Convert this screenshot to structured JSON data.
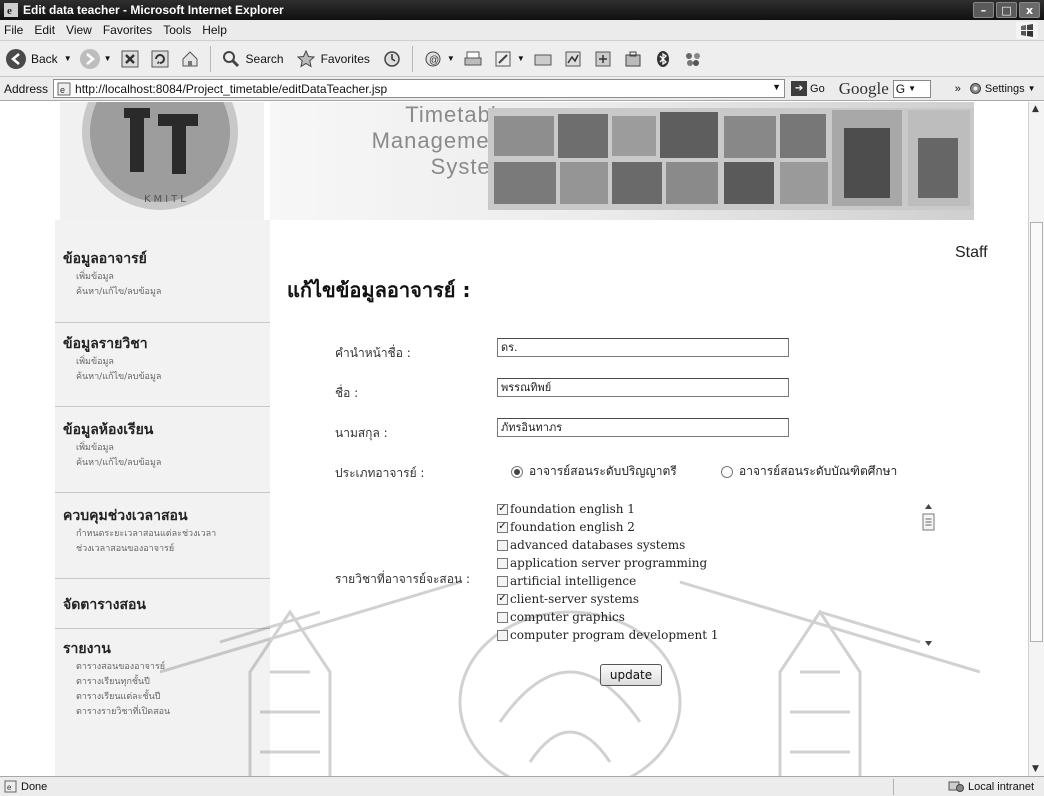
{
  "window": {
    "title": "Edit data teacher - Microsoft Internet Explorer"
  },
  "menu": [
    "File",
    "Edit",
    "View",
    "Favorites",
    "Tools",
    "Help"
  ],
  "toolbar": {
    "back_label": "Back",
    "search_label": "Search",
    "favorites_label": "Favorites"
  },
  "address": {
    "label": "Address",
    "url": "http://localhost:8084/Project_timetable/editDataTeacher.jsp",
    "go_label": "Go",
    "google_label": "Google",
    "google_field": "G",
    "more": "»",
    "settings_label": "Settings"
  },
  "logo": {
    "letters": "IT",
    "caption": "KMITL"
  },
  "banner": {
    "line1": "Timetable",
    "line2": "Management",
    "line3": "System"
  },
  "sidebar": {
    "groups": [
      {
        "title": "ข้อมูลอาจารย์",
        "items": [
          "เพิ่มข้อมูล",
          "ค้นหา/แก้ไข/ลบข้อมูล"
        ]
      },
      {
        "title": "ข้อมูลรายวิชา",
        "items": [
          "เพิ่มข้อมูล",
          "ค้นหา/แก้ไข/ลบข้อมูล"
        ]
      },
      {
        "title": "ข้อมูลห้องเรียน",
        "items": [
          "เพิ่มข้อมูล",
          "ค้นหา/แก้ไข/ลบข้อมูล"
        ]
      },
      {
        "title": "ควบคุมช่วงเวลาสอน",
        "items": [
          "กำหนดระยะเวลาสอนแต่ละช่วงเวลา",
          "ช่วงเวลาสอนของอาจารย์"
        ]
      },
      {
        "title": "จัดตารางสอน",
        "items": []
      },
      {
        "title": "รายงาน",
        "items": [
          "ตารางสอนของอาจารย์",
          "ตารางเรียนทุกชั้นปี",
          "ตารางเรียนแต่ละชั้นปี",
          "ตารางรายวิชาที่เปิดสอน"
        ]
      }
    ]
  },
  "page": {
    "role": "Staff",
    "heading": "แก้ไขข้อมูลอาจารย์ :"
  },
  "form": {
    "prefix_label": "คำนำหน้าชื่อ :",
    "prefix_value": "ดร.",
    "firstname_label": "ชื่อ :",
    "firstname_value": "พรรณทิพย์",
    "lastname_label": "นามสกุล :",
    "lastname_value": "ภัทรอินทาภร",
    "type_label": "ประเภทอาจารย์ :",
    "type_options": [
      "อาจารย์สอนระดับปริญญาตรี",
      "อาจารย์สอนระดับบัณฑิตศึกษา"
    ],
    "type_selected": "อาจารย์สอนระดับปริญญาตรี",
    "subjects_label": "รายวิชาที่อาจารย์จะสอน :",
    "subjects": [
      {
        "name": "foundation english 1",
        "checked": true
      },
      {
        "name": "foundation english 2",
        "checked": true
      },
      {
        "name": "advanced databases systems",
        "checked": false
      },
      {
        "name": "application server programming",
        "checked": false
      },
      {
        "name": "artificial intelligence",
        "checked": false
      },
      {
        "name": "client-server systems",
        "checked": true
      },
      {
        "name": "computer graphics",
        "checked": false
      },
      {
        "name": "computer program development 1",
        "checked": false
      }
    ],
    "update_label": "update"
  },
  "status": {
    "left": "Done",
    "zone": "Local intranet"
  }
}
